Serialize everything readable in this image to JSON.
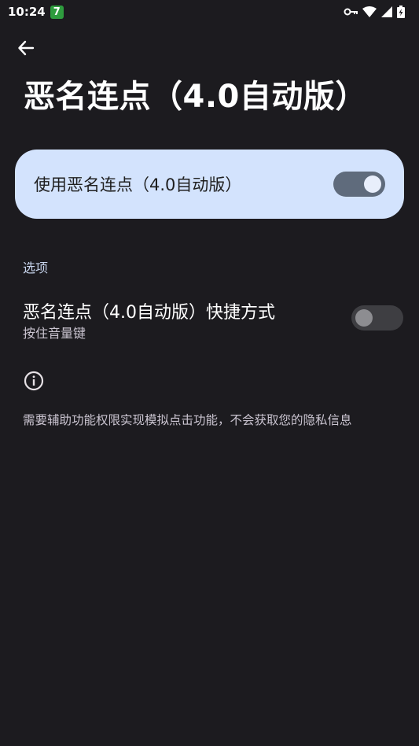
{
  "status_bar": {
    "time": "10:24",
    "app_badge": "7",
    "icons": [
      "vpn-key-icon",
      "wifi-icon",
      "signal-icon",
      "battery-charging-icon"
    ]
  },
  "toolbar": {
    "back_icon": "arrow-left-icon",
    "title": "恶名连点（4.0自动版）"
  },
  "main_switch": {
    "label": "使用恶名连点（4.0自动版）",
    "checked": true
  },
  "options": {
    "header": "选项",
    "shortcut": {
      "title": "恶名连点（4.0自动版）快捷方式",
      "summary": "按住音量键",
      "checked": false
    }
  },
  "footer": {
    "icon": "info-icon",
    "text": "需要辅助功能权限实现模拟点击功能，不会获取您的隐私信息"
  },
  "colors": {
    "background": "#1c1b1f",
    "card": "#d3e3fd",
    "switch_on_track": "#5f6b7c",
    "switch_off_track": "#3e3e42",
    "section_header": "#c7d4ec"
  }
}
